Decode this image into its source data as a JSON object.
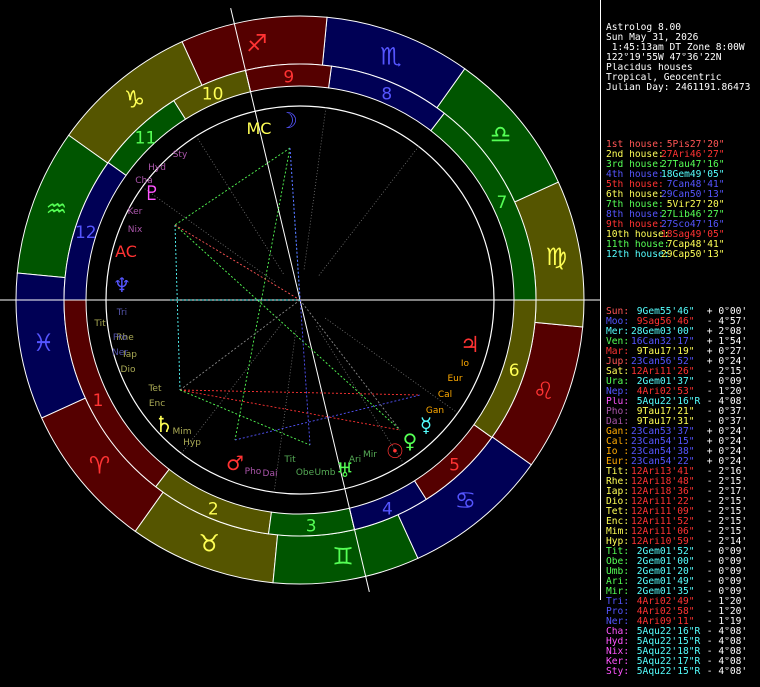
{
  "header": {
    "lines": [
      "Astrolog 8.00",
      "Sun May 31, 2026",
      " 1:45:13am DT Zone 8:00W",
      "122°19'55W 47°36'22N",
      "Placidus houses",
      "Tropical, Geocentric",
      "Julian Day: 2461191.86473"
    ]
  },
  "houses": [
    {
      "label": "1st house:",
      "pos": " 5Pis27'20\"",
      "color": "#ff5555",
      "poscolor": "#ff5555"
    },
    {
      "label": "2nd house:",
      "pos": "27Ari46'27\"",
      "color": "#ffff55",
      "poscolor": "#ff3333"
    },
    {
      "label": "3rd house:",
      "pos": "27Tau47'16\"",
      "color": "#55ff55",
      "poscolor": "#55ff55"
    },
    {
      "label": "4th house:",
      "pos": "18Gem49'05\"",
      "color": "#5555ff",
      "poscolor": "#55ffff"
    },
    {
      "label": "5th house:",
      "pos": " 7Can48'41\"",
      "color": "#ff3333",
      "poscolor": "#5555ff"
    },
    {
      "label": "6th house:",
      "pos": "29Can50'13\"",
      "color": "#ffff55",
      "poscolor": "#5555ff"
    },
    {
      "label": "7th house:",
      "pos": " 5Vir27'20\"",
      "color": "#55ff55",
      "poscolor": "#ffff55"
    },
    {
      "label": "8th house:",
      "pos": "27Lib46'27\"",
      "color": "#5555ff",
      "poscolor": "#55ff55"
    },
    {
      "label": "9th house:",
      "pos": "27Sco47'16\"",
      "color": "#ff3333",
      "poscolor": "#5555ff"
    },
    {
      "label": "10th house:",
      "pos": "18Sag49'05\"",
      "color": "#ffff55",
      "poscolor": "#ff3333"
    },
    {
      "label": "11th house:",
      "pos": " 7Cap48'41\"",
      "color": "#55ff55",
      "poscolor": "#ffff55"
    },
    {
      "label": "12th house:",
      "pos": "29Cap50'13\"",
      "color": "#55ffff",
      "poscolor": "#ffff55"
    }
  ],
  "planets": [
    {
      "name": "Sun:",
      "pos": " 9Gem55'46\"",
      "speed": " + 0°00'",
      "color": "#ff5555",
      "poscolor": "#55ffff"
    },
    {
      "name": "Moo:",
      "pos": " 9Sag56'46\"",
      "speed": " - 4°57'",
      "color": "#5555ff",
      "poscolor": "#ff3333"
    },
    {
      "name": "Mer:",
      "pos": "28Gem03'00\"",
      "speed": " + 2°08'",
      "color": "#55ffff",
      "poscolor": "#55ffff"
    },
    {
      "name": "Ven:",
      "pos": "16Can32'17\"",
      "speed": " + 1°54'",
      "color": "#55ff55",
      "poscolor": "#5555ff"
    },
    {
      "name": "Mar:",
      "pos": " 9Tau17'19\"",
      "speed": " + 0°27'",
      "color": "#ff3333",
      "poscolor": "#ffff55"
    },
    {
      "name": "Jup:",
      "pos": "23Can56'52\"",
      "speed": " + 0°24'",
      "color": "#ff5555",
      "poscolor": "#5555ff"
    },
    {
      "name": "Sat:",
      "pos": "12Ari11'26\"",
      "speed": " - 2°15'",
      "color": "#ffff55",
      "poscolor": "#ff3333"
    },
    {
      "name": "Ura:",
      "pos": " 2Gem01'37\"",
      "speed": " - 0°09'",
      "color": "#55ff55",
      "poscolor": "#55ffff"
    },
    {
      "name": "Nep:",
      "pos": " 4Ari02'53\"",
      "speed": " - 1°20'",
      "color": "#5555ff",
      "poscolor": "#ff3333"
    },
    {
      "name": "Plu:",
      "pos": " 5Aqu22'16\"R",
      "speed": " - 4°08'",
      "color": "#ff55ff",
      "poscolor": "#55ffff"
    },
    {
      "name": "Pho:",
      "pos": " 9Tau17'21\"",
      "speed": " - 0°37'",
      "color": "#aa55aa",
      "poscolor": "#ffff55"
    },
    {
      "name": "Dai:",
      "pos": " 9Tau17'31\"",
      "speed": " - 0°37'",
      "color": "#aa55aa",
      "poscolor": "#ffff55"
    },
    {
      "name": "Gan:",
      "pos": "23Can53'37\"",
      "speed": " + 0°24'",
      "color": "#ffaa00",
      "poscolor": "#5555ff"
    },
    {
      "name": "Cal:",
      "pos": "23Can54'15\"",
      "speed": " + 0°24'",
      "color": "#ffaa00",
      "poscolor": "#5555ff"
    },
    {
      "name": "Io :",
      "pos": "23Can54'38\"",
      "speed": " + 0°24'",
      "color": "#ffaa00",
      "poscolor": "#5555ff"
    },
    {
      "name": "Eur:",
      "pos": "23Can54'22\"",
      "speed": " + 0°24'",
      "color": "#ffaa00",
      "poscolor": "#5555ff"
    },
    {
      "name": "Tit:",
      "pos": "12Ari13'41\"",
      "speed": " - 2°16'",
      "color": "#ffff55",
      "poscolor": "#ff3333"
    },
    {
      "name": "Rhe:",
      "pos": "12Ari18'48\"",
      "speed": " - 2°15'",
      "color": "#ffff55",
      "poscolor": "#ff3333"
    },
    {
      "name": "Iap:",
      "pos": "12Ari18'36\"",
      "speed": " - 2°17'",
      "color": "#ffff55",
      "poscolor": "#ff3333"
    },
    {
      "name": "Dio:",
      "pos": "12Ari11'22\"",
      "speed": " - 2°15'",
      "color": "#ffff55",
      "poscolor": "#ff3333"
    },
    {
      "name": "Tet:",
      "pos": "12Ari11'09\"",
      "speed": " - 2°15'",
      "color": "#ffff55",
      "poscolor": "#ff3333"
    },
    {
      "name": "Enc:",
      "pos": "12Ari11'52\"",
      "speed": " - 2°15'",
      "color": "#ffff55",
      "poscolor": "#ff3333"
    },
    {
      "name": "Mim:",
      "pos": "12Ari11'06\"",
      "speed": " - 2°15'",
      "color": "#ffff55",
      "poscolor": "#ff3333"
    },
    {
      "name": "Hyp:",
      "pos": "12Ari10'59\"",
      "speed": " - 2°14'",
      "color": "#ffff55",
      "poscolor": "#ff3333"
    },
    {
      "name": "Tit:",
      "pos": " 2Gem01'52\"",
      "speed": " - 0°09'",
      "color": "#55ff55",
      "poscolor": "#55ffff"
    },
    {
      "name": "Obe:",
      "pos": " 2Gem01'00\"",
      "speed": " - 0°09'",
      "color": "#55ff55",
      "poscolor": "#55ffff"
    },
    {
      "name": "Umb:",
      "pos": " 2Gem01'20\"",
      "speed": " - 0°09'",
      "color": "#55ff55",
      "poscolor": "#55ffff"
    },
    {
      "name": "Ari:",
      "pos": " 2Gem01'49\"",
      "speed": " - 0°09'",
      "color": "#55ff55",
      "poscolor": "#55ffff"
    },
    {
      "name": "Mir:",
      "pos": " 2Gem01'35\"",
      "speed": " - 0°09'",
      "color": "#55ff55",
      "poscolor": "#55ffff"
    },
    {
      "name": "Tri:",
      "pos": " 4Ari02'49\"",
      "speed": " - 1°20'",
      "color": "#5555ff",
      "poscolor": "#ff3333"
    },
    {
      "name": "Pro:",
      "pos": " 4Ari02'58\"",
      "speed": " - 1°20'",
      "color": "#5555ff",
      "poscolor": "#ff3333"
    },
    {
      "name": "Ner:",
      "pos": " 4Ari09'11\"",
      "speed": " - 1°19'",
      "color": "#5555ff",
      "poscolor": "#ff3333"
    },
    {
      "name": "Cha:",
      "pos": " 5Aqu22'16\"R",
      "speed": " - 4°08'",
      "color": "#ff55ff",
      "poscolor": "#55ffff"
    },
    {
      "name": "Hyd:",
      "pos": " 5Aqu22'15\"R",
      "speed": " - 4°08'",
      "color": "#ff55ff",
      "poscolor": "#55ffff"
    },
    {
      "name": "Nix:",
      "pos": " 5Aqu22'18\"R",
      "speed": " - 4°08'",
      "color": "#ff55ff",
      "poscolor": "#55ffff"
    },
    {
      "name": "Ker:",
      "pos": " 5Aqu22'17\"R",
      "speed": " - 4°08'",
      "color": "#ff55ff",
      "poscolor": "#55ffff"
    },
    {
      "name": "Sty:",
      "pos": " 5Aqu22'15\"R",
      "speed": " - 4°08'",
      "color": "#ff55ff",
      "poscolor": "#55ffff"
    }
  ],
  "wheel": {
    "signs": [
      {
        "glyph": "♈",
        "color": "#ff3333"
      },
      {
        "glyph": "♉",
        "color": "#ffff55"
      },
      {
        "glyph": "♊",
        "color": "#55ff55"
      },
      {
        "glyph": "♋",
        "color": "#5555ff"
      },
      {
        "glyph": "♌",
        "color": "#ff3333"
      },
      {
        "glyph": "♍",
        "color": "#ffff55"
      },
      {
        "glyph": "♎",
        "color": "#55ff55"
      },
      {
        "glyph": "♏",
        "color": "#5555ff"
      },
      {
        "glyph": "♐",
        "color": "#ff3333"
      },
      {
        "glyph": "♑",
        "color": "#ffff55"
      },
      {
        "glyph": "♒",
        "color": "#55ff55"
      },
      {
        "glyph": "♓",
        "color": "#5555ff"
      }
    ],
    "sign_fills": [
      "#550000",
      "#555500",
      "#005500",
      "#000055"
    ],
    "house_numbers": [
      {
        "n": "1",
        "color": "#ff3333"
      },
      {
        "n": "2",
        "color": "#ffff55"
      },
      {
        "n": "3",
        "color": "#55ff55"
      },
      {
        "n": "4",
        "color": "#5555ff"
      },
      {
        "n": "5",
        "color": "#ff3333"
      },
      {
        "n": "6",
        "color": "#ffff55"
      },
      {
        "n": "7",
        "color": "#55ff55"
      },
      {
        "n": "8",
        "color": "#5555ff"
      },
      {
        "n": "9",
        "color": "#ff3333"
      },
      {
        "n": "10",
        "color": "#ffff55"
      },
      {
        "n": "11",
        "color": "#55ff55"
      },
      {
        "n": "12",
        "color": "#5555ff"
      }
    ],
    "angle_labels": {
      "ac": "AC",
      "mc": "MC"
    },
    "bodies": [
      {
        "label": "☉",
        "color": "#ff3333"
      },
      {
        "label": "☽",
        "color": "#5555ff"
      },
      {
        "label": "☿",
        "color": "#55ffff"
      },
      {
        "label": "♀",
        "color": "#55ff55"
      },
      {
        "label": "♂",
        "color": "#ff3333"
      },
      {
        "label": "♃",
        "color": "#ff3333"
      },
      {
        "label": "♄",
        "color": "#ffff55"
      },
      {
        "label": "♅",
        "color": "#55ff55"
      },
      {
        "label": "♆",
        "color": "#5555ff"
      },
      {
        "label": "♇",
        "color": "#ff55ff"
      },
      {
        "label": "Pho",
        "color": "#aa55aa"
      },
      {
        "label": "Dai",
        "color": "#aa55aa"
      },
      {
        "label": "Gan",
        "color": "#ffaa00"
      },
      {
        "label": "Cal",
        "color": "#ffaa00"
      },
      {
        "label": "Io",
        "color": "#ffaa00"
      },
      {
        "label": "Eur",
        "color": "#ffaa00"
      },
      {
        "label": "Tit",
        "color": "#aaaa55"
      },
      {
        "label": "Rhe",
        "color": "#aaaa55"
      },
      {
        "label": "Iap",
        "color": "#aaaa55"
      },
      {
        "label": "Dio",
        "color": "#aaaa55"
      },
      {
        "label": "Tet",
        "color": "#aaaa55"
      },
      {
        "label": "Enc",
        "color": "#aaaa55"
      },
      {
        "label": "Mim",
        "color": "#aaaa55"
      },
      {
        "label": "Hyp",
        "color": "#aaaa55"
      },
      {
        "label": "Tit",
        "color": "#55aa55"
      },
      {
        "label": "Obe",
        "color": "#55aa55"
      },
      {
        "label": "Umb",
        "color": "#55aa55"
      },
      {
        "label": "Ari",
        "color": "#55aa55"
      },
      {
        "label": "Mir",
        "color": "#55aa55"
      },
      {
        "label": "Tri",
        "color": "#5555aa"
      },
      {
        "label": "Pro",
        "color": "#5555aa"
      },
      {
        "label": "Ner",
        "color": "#5555aa"
      },
      {
        "label": "Cha",
        "color": "#aa55aa"
      },
      {
        "label": "Hyd",
        "color": "#aa55aa"
      },
      {
        "label": "Nix",
        "color": "#aa55aa"
      },
      {
        "label": "Ker",
        "color": "#aa55aa"
      },
      {
        "label": "Sty",
        "color": "#aa55aa"
      }
    ]
  }
}
